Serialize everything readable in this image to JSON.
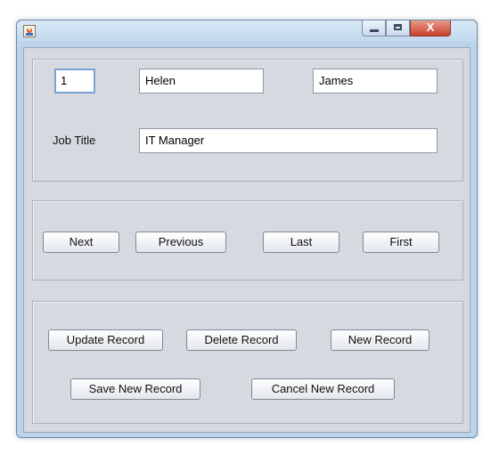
{
  "window": {
    "app_icon": "java-cup-icon",
    "controls": {
      "minimize_icon": "minimize-icon",
      "maximize_icon": "maximize-icon",
      "close_icon": "close-icon",
      "close_glyph": "X"
    }
  },
  "record": {
    "id": "1",
    "first_name": "Helen",
    "last_name": "James",
    "job_title_label": "Job Title",
    "job_title": "IT Manager"
  },
  "navigation": {
    "next": "Next",
    "previous": "Previous",
    "last": "Last",
    "first": "First"
  },
  "actions": {
    "update": "Update Record",
    "delete": "Delete Record",
    "new": "New Record",
    "save_new": "Save New Record",
    "cancel_new": "Cancel New Record"
  },
  "colors": {
    "title_bar": "#c2d8ee",
    "client_bg": "#d6d9df",
    "close_button": "#c7402b"
  }
}
